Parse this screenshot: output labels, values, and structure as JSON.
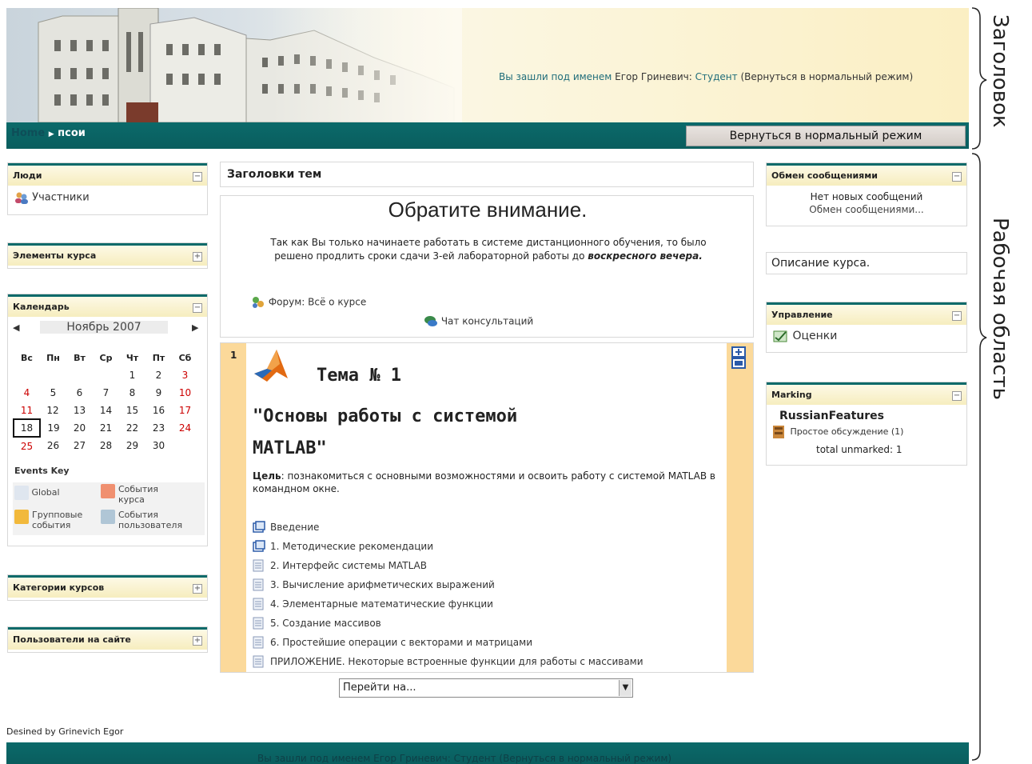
{
  "header": {
    "login_prefix": "Вы зашли под именем",
    "user_name": "Егор Гриневич",
    "role": "Студент",
    "return_link": "(Вернуться в нормальный режим)"
  },
  "navbar": {
    "home": "Home",
    "arrow": "▶",
    "course": "псои",
    "return_button": "Вернуться в нормальный режим"
  },
  "left": {
    "people": {
      "title": "Люди",
      "toggle": "−",
      "participants": "Участники"
    },
    "elements": {
      "title": "Элементы курса",
      "toggle": "+"
    },
    "calendar": {
      "title": "Календарь",
      "toggle": "−",
      "prev": "◀",
      "next": "▶",
      "month": "Ноябрь 2007",
      "days": [
        "Вс",
        "Пн",
        "Вт",
        "Ср",
        "Чт",
        "Пт",
        "Сб"
      ],
      "weeks": [
        [
          "",
          "",
          "",
          "",
          "1",
          "2",
          "3"
        ],
        [
          "4",
          "5",
          "6",
          "7",
          "8",
          "9",
          "10"
        ],
        [
          "11",
          "12",
          "13",
          "14",
          "15",
          "16",
          "17"
        ],
        [
          "18",
          "19",
          "20",
          "21",
          "22",
          "23",
          "24"
        ],
        [
          "25",
          "26",
          "27",
          "28",
          "29",
          "30",
          ""
        ]
      ],
      "today": "18",
      "events_key_title": "Events Key",
      "ev_global": "Global",
      "ev_course_1": "События",
      "ev_course_2": "курса",
      "ev_group_1": "Групповые",
      "ev_group_2": "события",
      "ev_user_1": "События",
      "ev_user_2": "пользователя"
    },
    "categories": {
      "title": "Категории курсов",
      "toggle": "+"
    },
    "online": {
      "title": "Пользователи на сайте",
      "toggle": "+"
    }
  },
  "center": {
    "topics_header": "Заголовки тем",
    "news_title": "Обратите внимание.",
    "news_text_1": "Так как Вы только начинаете работать в системе дистанционного обучения, то было решено продлить сроки сдачи 3-ей лабораторной работы до",
    "news_text_em": "воскресного вечера.",
    "forum": "Форум: Всё о курсе",
    "chat": "Чат консультаций",
    "topic_number": "1",
    "topic_title": "Тема № 1",
    "topic_subtitle": "\"Основы работы с системой MATLAB\"",
    "goal_label": "Цель",
    "goal_text": ": познакомиться с основными возможностями и освоить работу с системой MATLAB в командном окне.",
    "resources": [
      "Введение",
      "1. Методические рекомендации",
      "2. Интерфейс системы MATLAB",
      "3. Вычисление арифметических выражений",
      "4. Элементарные математические функции",
      "5. Создание массивов",
      "6. Простейшие операции с векторами и матрицами",
      "ПРИЛОЖЕНИЕ. Некоторые встроенные функции для работы с массивами"
    ],
    "goto": "Перейти на..."
  },
  "right": {
    "messages": {
      "title": "Обмен сообщениями",
      "toggle": "−",
      "none": "Нет новых сообщений",
      "link": "Обмен сообщениями..."
    },
    "course_desc": "Описание курса.",
    "admin": {
      "title": "Управление",
      "toggle": "−",
      "grades": "Оценки"
    },
    "marking": {
      "title": "Marking",
      "toggle": "−",
      "course": "RussianFeatures",
      "discussion": "Простое обсуждение (1)",
      "total": "total unmarked: 1"
    }
  },
  "footer": {
    "credit": "Desined by Grinevich Egor",
    "bar_text": "Вы зашли под именем Егор Гриневич: Студент (Вернуться в нормальный режим)"
  },
  "annotations": {
    "header": "Заголовок",
    "work_area": "Рабочая область"
  },
  "colors": {
    "teal": "#0b6a6a",
    "cream": "#f6edbe",
    "weekend": "#cc0000",
    "topic_side": "#fbd99a",
    "link": "#1f6d7a"
  }
}
